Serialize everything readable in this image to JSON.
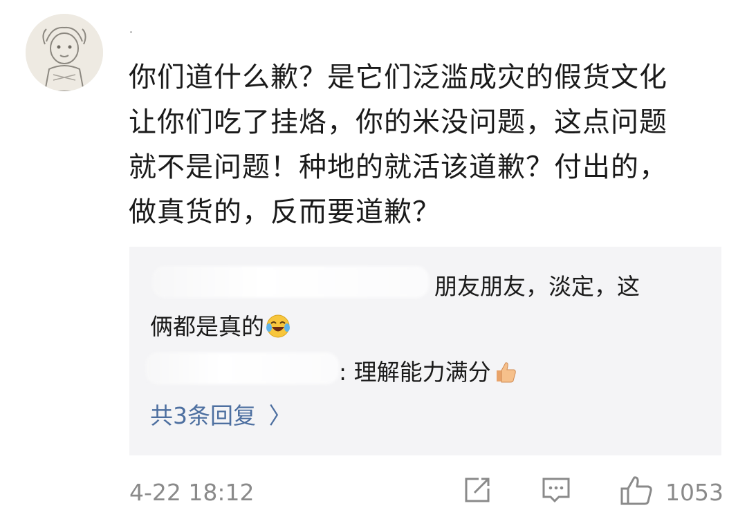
{
  "comment": {
    "lines": [
      "你们道什么歉？是它们泛滥成灾的假货文化",
      "让你们吃了挂烙，你的米没问题，这点问题",
      "就不是问题！种地的就活该道歉？付出的，",
      "做真货的，反而要道歉？"
    ]
  },
  "replies": {
    "first_line": "朋友朋友，淡定，这",
    "first_line_cont": "俩都是真的",
    "second_line": ": 理解能力满分",
    "emoji_1": "laughing-crying-emoji",
    "emoji_2": "thumbs-up-emoji",
    "more_label": "共3条回复",
    "more_chevron": "〉"
  },
  "footer": {
    "timestamp": "4-22 18:12",
    "like_count": "1053",
    "share_icon": "share-icon",
    "reply_icon": "comment-icon",
    "like_icon": "thumbs-up-icon"
  },
  "colors": {
    "text": "#1a1a1a",
    "link": "#4d6fa0",
    "muted": "#8a8a8a",
    "reply_bg": "#f4f4f6"
  }
}
